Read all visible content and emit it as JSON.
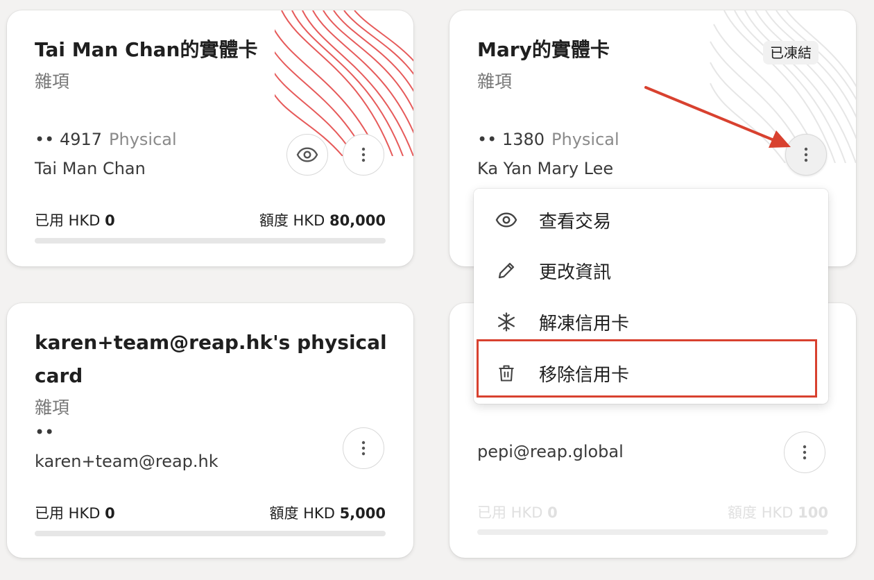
{
  "cards": [
    {
      "title": "Tai Man Chan的實體卡",
      "category": "雜項",
      "last4": "•• 4917",
      "type": "Physical",
      "holder": "Tai Man Chan",
      "used_label": "已用 HKD",
      "used_value": "0",
      "limit_label": "額度 HKD",
      "limit_value": "80,000",
      "usage_fraction": 0
    },
    {
      "title": "Mary的實體卡",
      "category": "雜項",
      "badge": "已凍結",
      "last4": "•• 1380",
      "type": "Physical",
      "holder": "Ka Yan Mary Lee"
    },
    {
      "title_line1": "karen+team@reap.hk's physical",
      "title_line2": "card",
      "category": "雜項",
      "last4": "••",
      "holder": "karen+team@reap.hk",
      "used_label": "已用 HKD",
      "used_value": "0",
      "limit_label": "額度 HKD",
      "limit_value": "5,000",
      "usage_fraction": 0
    },
    {
      "holder": "pepi@reap.global",
      "used_label": "已用 HKD",
      "used_value": "0",
      "limit_label": "額度 HKD",
      "limit_value": "100",
      "usage_fraction": 0
    }
  ],
  "menu": {
    "items": [
      {
        "label": "查看交易",
        "icon": "eye-icon"
      },
      {
        "label": "更改資訊",
        "icon": "pencil-icon"
      },
      {
        "label": "解凍信用卡",
        "icon": "snowflake-icon"
      },
      {
        "label": "移除信用卡",
        "icon": "trash-icon"
      }
    ]
  },
  "colors": {
    "accent": "#d8412f",
    "card_bg": "#ffffff",
    "page_bg": "#f3f2f1",
    "muted_text": "#777777"
  }
}
